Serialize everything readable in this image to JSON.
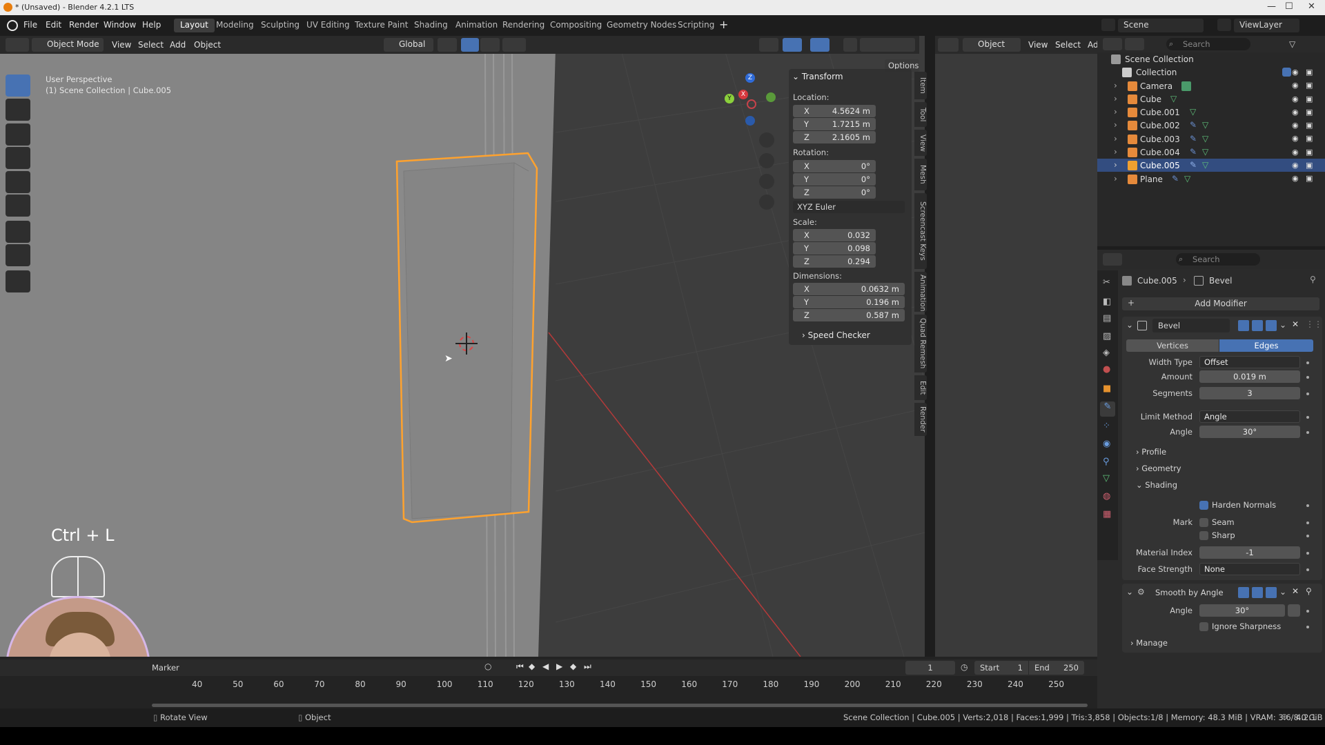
{
  "window": {
    "title": "* (Unsaved) - Blender 4.2.1 LTS"
  },
  "menu": [
    "File",
    "Edit",
    "Render",
    "Window",
    "Help"
  ],
  "workspaces": [
    "Layout",
    "Modeling",
    "Sculpting",
    "UV Editing",
    "Texture Paint",
    "Shading",
    "Animation",
    "Rendering",
    "Compositing",
    "Geometry Nodes",
    "Scripting"
  ],
  "viewport": {
    "mode": "Object Mode",
    "menus": [
      "View",
      "Select",
      "Add",
      "Object"
    ],
    "orientation": "Global",
    "perspective": "User Perspective",
    "collection_path": "(1) Scene Collection | Cube.005",
    "options": "Options",
    "right_header": {
      "pivot": "Object",
      "menus": [
        "View",
        "Select",
        "Ad"
      ]
    },
    "shortcut": "Ctrl + L"
  },
  "npanel": {
    "title": "Transform",
    "location_label": "Location:",
    "location": {
      "x": "4.5624 m",
      "y": "1.7215 m",
      "z": "2.1605 m"
    },
    "rotation_label": "Rotation:",
    "rotation": {
      "x": "0°",
      "y": "0°",
      "z": "0°"
    },
    "rotation_mode": "XYZ Euler",
    "scale_label": "Scale:",
    "scale": {
      "x": "0.032",
      "y": "0.098",
      "z": "0.294"
    },
    "dimensions_label": "Dimensions:",
    "dimensions": {
      "x": "0.0632 m",
      "y": "0.196 m",
      "z": "0.587 m"
    },
    "speed_checker": "Speed Checker",
    "axis": {
      "x": "X",
      "y": "Y",
      "z": "Z"
    },
    "tabs": [
      "Item",
      "Tool",
      "View",
      "Mesh",
      "Screencast Keys",
      "Animation",
      "Quad Remesh",
      "Edit",
      "Render"
    ]
  },
  "outliner": {
    "scene": "Scene",
    "view_layer": "ViewLayer",
    "search_placeholder": "Search",
    "scene_collection": "Scene Collection",
    "collection": "Collection",
    "items": [
      "Camera",
      "Cube",
      "Cube.001",
      "Cube.002",
      "Cube.003",
      "Cube.004",
      "Cube.005",
      "Plane"
    ],
    "selected": "Cube.005"
  },
  "properties": {
    "search_placeholder": "Search",
    "breadcrumb_object": "Cube.005",
    "breadcrumb_modifier": "Bevel",
    "add_modifier": "Add Modifier",
    "bevel": {
      "name": "Bevel",
      "affect": [
        "Vertices",
        "Edges"
      ],
      "width_type_label": "Width Type",
      "width_type": "Offset",
      "amount_label": "Amount",
      "amount": "0.019 m",
      "segments_label": "Segments",
      "segments": "3",
      "limit_method_label": "Limit Method",
      "limit_method": "Angle",
      "angle_label": "Angle",
      "angle": "30°",
      "profile": "Profile",
      "geometry": "Geometry",
      "shading": "Shading",
      "harden_normals": "Harden Normals",
      "mark_label": "Mark",
      "seam": "Seam",
      "sharp": "Sharp",
      "material_index_label": "Material Index",
      "material_index": "-1",
      "face_strength_label": "Face Strength",
      "face_strength": "None"
    },
    "smooth": {
      "name": "Smooth by Angle",
      "angle_label": "Angle",
      "angle": "30°",
      "ignore_sharpness": "Ignore Sharpness",
      "manage": "Manage"
    }
  },
  "timeline": {
    "marker": "Marker",
    "frame": "1",
    "start_label": "Start",
    "start": "1",
    "end_label": "End",
    "end": "250",
    "ticks": [
      "40",
      "50",
      "60",
      "70",
      "80",
      "90",
      "100",
      "110",
      "120",
      "130",
      "140",
      "150",
      "160",
      "170",
      "180",
      "190",
      "200",
      "210",
      "220",
      "230",
      "240",
      "250"
    ]
  },
  "status": {
    "left": "Rotate View",
    "middle": "Object",
    "right": "Scene Collection | Cube.005 | Verts:2,018 | Faces:1,999 | Tris:3,858 | Objects:1/8 | Memory: 48.3 MiB | VRAM: 3.6/8.0 GiB",
    "version": "4.2.1"
  },
  "colors": {
    "accent": "#4772b3",
    "selection_outline": "#f0a030",
    "blender_orange": "#e87d0d"
  }
}
